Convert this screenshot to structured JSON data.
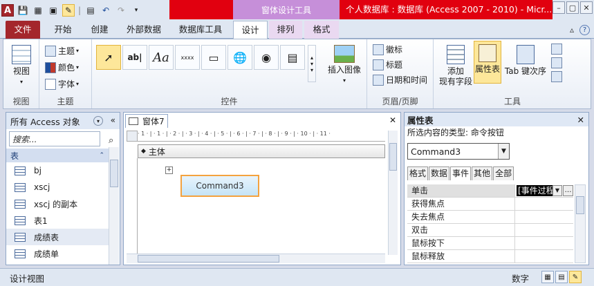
{
  "titlebar": {
    "context_label": "窗体设计工具",
    "window_title": "个人数据库 : 数据库 (Access 2007 - 2010)  -  Micr...",
    "app_icon": "A"
  },
  "tabs": {
    "file": "文件",
    "home": "开始",
    "create": "创建",
    "external": "外部数据",
    "dbtools": "数据库工具",
    "design": "设计",
    "arrange": "排列",
    "format": "格式"
  },
  "ribbon": {
    "views": {
      "label": "视图",
      "btn": "视图"
    },
    "themes": {
      "label": "主题",
      "theme": "主题",
      "colors": "颜色",
      "fonts": "字体"
    },
    "controls": {
      "label": "控件",
      "textbox": "ab|",
      "label_ctrl": "Aa",
      "button": "xxxx"
    },
    "insert_image": "插入图像",
    "header_footer": {
      "label": "页眉/页脚",
      "logo": "徽标",
      "title": "标题",
      "datetime": "日期和时间"
    },
    "tools": {
      "label": "工具",
      "add_fields": "添加\n现有字段",
      "add_fields_1": "添加",
      "add_fields_2": "现有字段",
      "property_sheet": "属性表",
      "tab_order": "Tab 键次序"
    }
  },
  "nav": {
    "header": "所有 Access 对象",
    "search_placeholder": "搜索...",
    "group": "表",
    "items": [
      "bj",
      "xscj",
      "xscj 的副本",
      "表1",
      "成绩表",
      "成绩单"
    ]
  },
  "doc": {
    "tab": "窗体7",
    "section": "主体",
    "command_button": "Command3",
    "ruler_marks": "· 1 · | · 1 · | · 2 · | · 3 · | · 4 · | · 5 · | · 6 · | · 7 · | · 8 · | · 9 · | · 10 · | · 11 ·"
  },
  "property_sheet": {
    "title": "属性表",
    "selection_type": "所选内容的类型:  命令按钮",
    "selected_object": "Command3",
    "tabs": [
      "格式",
      "数据",
      "事件",
      "其他",
      "全部"
    ],
    "active_tab": "事件",
    "rows": [
      {
        "name": "单击",
        "value": "[事件过程]"
      },
      {
        "name": "获得焦点",
        "value": ""
      },
      {
        "name": "失去焦点",
        "value": ""
      },
      {
        "name": "双击",
        "value": ""
      },
      {
        "name": "鼠标按下",
        "value": ""
      },
      {
        "name": "鼠标释放",
        "value": ""
      }
    ]
  },
  "status": {
    "left": "设计视图",
    "right": "数字"
  },
  "colors": {
    "title_red": "#e1000f",
    "file_tab": "#a4262c",
    "context_purple": "#c68fd9",
    "selection_yellow": "#fde79a"
  }
}
